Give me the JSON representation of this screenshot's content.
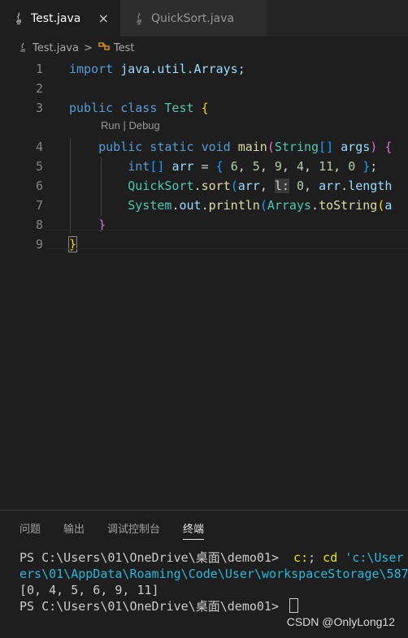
{
  "tabs": [
    {
      "label": "Test.java",
      "active": true,
      "icon": "java-icon",
      "close": "×"
    },
    {
      "label": "QuickSort.java",
      "active": false,
      "icon": "java-icon"
    }
  ],
  "breadcrumb": {
    "file": "Test.java",
    "separator": ">",
    "symbol": "Test",
    "symbol_icon": "class-icon"
  },
  "editor": {
    "line_numbers": [
      "1",
      "2",
      "3",
      "4",
      "5",
      "6",
      "7",
      "8",
      "9"
    ],
    "codelens": "Run | Debug",
    "lines": [
      [
        {
          "t": "import",
          "c": "kw"
        },
        {
          "t": " java.util.Arrays;",
          "c": "vr"
        }
      ],
      [],
      [
        {
          "t": "public",
          "c": "kw"
        },
        {
          "t": " "
        },
        {
          "t": "class",
          "c": "kw"
        },
        {
          "t": " "
        },
        {
          "t": "Test",
          "c": "ty"
        },
        {
          "t": " "
        },
        {
          "t": "{",
          "c": "br1"
        }
      ],
      [
        {
          "t": "    "
        },
        {
          "t": "public",
          "c": "kw"
        },
        {
          "t": " "
        },
        {
          "t": "static",
          "c": "kw"
        },
        {
          "t": " "
        },
        {
          "t": "void",
          "c": "kw"
        },
        {
          "t": " "
        },
        {
          "t": "main",
          "c": "fn"
        },
        {
          "t": "(",
          "c": "br2"
        },
        {
          "t": "String",
          "c": "ty"
        },
        {
          "t": "[]",
          "c": "br3"
        },
        {
          "t": " "
        },
        {
          "t": "args",
          "c": "vr"
        },
        {
          "t": ")",
          "c": "br2"
        },
        {
          "t": " {",
          "c": "br2"
        }
      ],
      [
        {
          "t": "        "
        },
        {
          "t": "int",
          "c": "kw"
        },
        {
          "t": "[]",
          "c": "br3"
        },
        {
          "t": " "
        },
        {
          "t": "arr",
          "c": "vr"
        },
        {
          "t": " = "
        },
        {
          "t": "{",
          "c": "br3"
        },
        {
          "t": " "
        },
        {
          "t": "6",
          "c": "nu"
        },
        {
          "t": ", "
        },
        {
          "t": "5",
          "c": "nu"
        },
        {
          "t": ", "
        },
        {
          "t": "9",
          "c": "nu"
        },
        {
          "t": ", "
        },
        {
          "t": "4",
          "c": "nu"
        },
        {
          "t": ", "
        },
        {
          "t": "11",
          "c": "nu"
        },
        {
          "t": ", "
        },
        {
          "t": "0",
          "c": "nu"
        },
        {
          "t": " "
        },
        {
          "t": "}",
          "c": "br3"
        },
        {
          "t": ";"
        }
      ],
      [
        {
          "t": "        "
        },
        {
          "t": "QuickSort",
          "c": "ty"
        },
        {
          "t": "."
        },
        {
          "t": "sort",
          "c": "fn"
        },
        {
          "t": "(",
          "c": "br3"
        },
        {
          "t": "arr",
          "c": "vr"
        },
        {
          "t": ", "
        },
        {
          "t": "l:",
          "c": "hint"
        },
        {
          "t": " "
        },
        {
          "t": "0",
          "c": "nu"
        },
        {
          "t": ", "
        },
        {
          "t": "arr",
          "c": "vr"
        },
        {
          "t": "."
        },
        {
          "t": "length",
          "c": "vr"
        }
      ],
      [
        {
          "t": "        "
        },
        {
          "t": "System",
          "c": "ty"
        },
        {
          "t": "."
        },
        {
          "t": "out",
          "c": "vr"
        },
        {
          "t": "."
        },
        {
          "t": "println",
          "c": "fn"
        },
        {
          "t": "(",
          "c": "br3"
        },
        {
          "t": "Arrays",
          "c": "ty"
        },
        {
          "t": "."
        },
        {
          "t": "toString",
          "c": "fn"
        },
        {
          "t": "(",
          "c": "br1"
        },
        {
          "t": "a",
          "c": "vr"
        }
      ],
      [
        {
          "t": "    "
        },
        {
          "t": "}",
          "c": "br2"
        }
      ],
      [
        {
          "t": "}",
          "c": "br1 cursor-brace"
        }
      ]
    ]
  },
  "panel": {
    "tabs": [
      {
        "label": "问题",
        "active": false
      },
      {
        "label": "输出",
        "active": false
      },
      {
        "label": "调试控制台",
        "active": false
      },
      {
        "label": "终端",
        "active": true
      }
    ],
    "terminal": [
      [
        {
          "t": "PS C:\\Users\\01\\OneDrive\\桌面\\demo01> ",
          "c": "cmd"
        },
        {
          "t": " c:",
          "c": "yl"
        },
        {
          "t": "; ",
          "c": "cmd"
        },
        {
          "t": "cd",
          "c": "yl"
        },
        {
          "t": " 'c:\\User",
          "c": "cy"
        }
      ],
      [
        {
          "t": "ers\\01\\AppData\\Roaming\\Code\\User\\workspaceStorage\\587",
          "c": "cy"
        }
      ],
      [
        {
          "t": "[0, 4, 5, 6, 9, 11]",
          "c": "cmd"
        }
      ],
      [
        {
          "t": "PS C:\\Users\\01\\OneDrive\\桌面\\demo01> ",
          "c": "cmd"
        }
      ]
    ]
  },
  "watermark": "CSDN @OnlyLong12"
}
